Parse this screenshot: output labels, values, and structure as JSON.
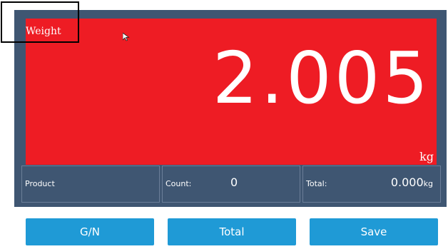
{
  "display": {
    "label": "Weight",
    "value": "2.005",
    "unit": "kg"
  },
  "info": {
    "product_label": "Product",
    "count_label": "Count:",
    "count_value": "0",
    "total_label": "Total:",
    "total_value": "0.000",
    "total_unit": "kg"
  },
  "buttons": {
    "gn": "G/N",
    "total": "Total",
    "save": "Save"
  },
  "colors": {
    "panel": "#3f5672",
    "display": "#ee1c24",
    "button": "#1f9ad6"
  },
  "icons": [
    "mouse-cursor-icon"
  ]
}
